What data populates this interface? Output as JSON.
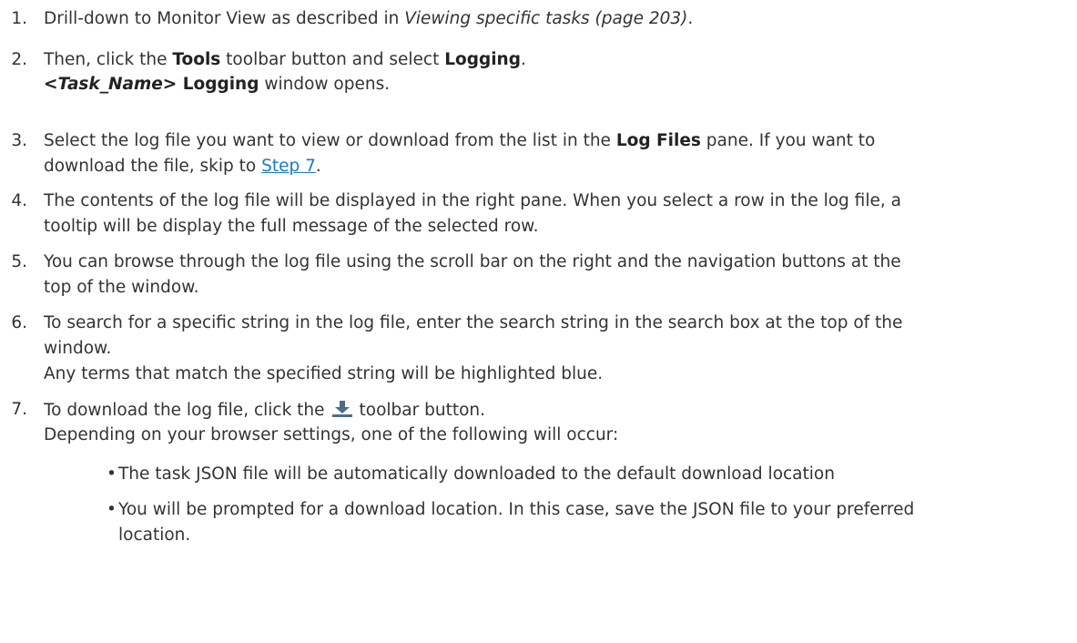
{
  "steps": [
    {
      "number": "1.",
      "parts": {
        "a": "Drill-down to Monitor View as described in ",
        "ref": "Viewing specific tasks (page 203)",
        "b": "."
      }
    },
    {
      "number": "2.",
      "parts": {
        "a": "Then, click the ",
        "tools": "Tools",
        "b": " toolbar button and select ",
        "logging": "Logging",
        "c": "."
      },
      "note": {
        "lt": "<",
        "task_name": "Task_Name",
        "gt_logging": "> Logging",
        "rest": " window opens."
      }
    },
    {
      "number": "3.",
      "line1": {
        "a": "Select the log file you want to view or download from the list in the ",
        "log_files": "Log Files",
        "b": " pane. If you want to"
      },
      "line2": {
        "a": "download the file, skip to ",
        "link": "Step 7",
        "b": "."
      }
    },
    {
      "number": "4.",
      "line1": "The contents of the log file will be displayed in the right pane. When you select a row in the log file, a",
      "line2": "tooltip will be display the full message of the selected row."
    },
    {
      "number": "5.",
      "line1": "You can browse through the log file using the scroll bar on the right and the navigation buttons at the",
      "line2": "top of the window."
    },
    {
      "number": "6.",
      "line1": "To search for a specific string in the log file, enter the search string in the search box at the top of the",
      "line2": "window.",
      "note": "Any terms that match the specified string will be highlighted blue."
    },
    {
      "number": "7.",
      "parts": {
        "a": "To download the log file, click the",
        "icon": "download-icon",
        "b": "toolbar button."
      },
      "note": "Depending on your browser settings, one of the following will occur:",
      "bullets": [
        {
          "mark": "•",
          "line1": "The task JSON file will be automatically downloaded to the default download location"
        },
        {
          "mark": "•",
          "line1": "You will be prompted for a download location. In this case, save the JSON file to your preferred",
          "line2": "location."
        }
      ]
    }
  ],
  "colors": {
    "text": "#333333",
    "link": "#1a7ac4",
    "icon": "#4a6e8a"
  }
}
